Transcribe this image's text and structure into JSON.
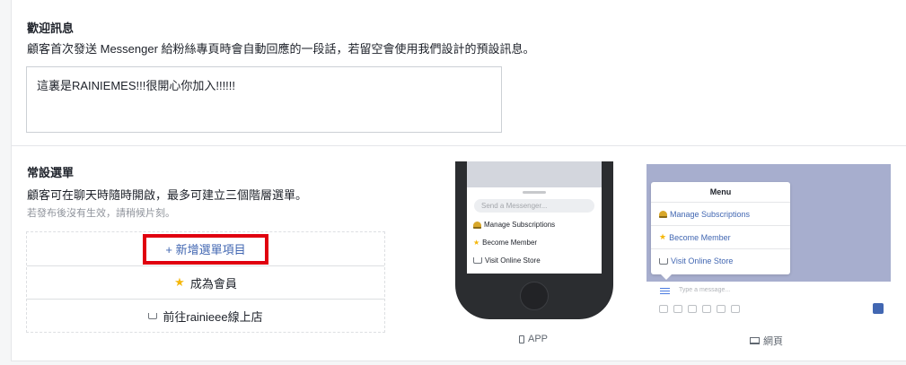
{
  "welcome": {
    "title": "歡迎訊息",
    "description": "顧客首次發送 Messenger 給粉絲專頁時會自動回應的一段話，若留空會使用我們設計的預設訊息。",
    "value": "這裏是RAINIEMES!!!很開心你加入!!!!!!"
  },
  "persistent_menu": {
    "title": "常設選單",
    "description": "顧客可在聊天時隨時開啟，最多可建立三個階層選單。",
    "hint": "若發布後沒有生效，請稍候片刻。",
    "add_label": "+ 新增選單項目",
    "items": [
      {
        "icon": "star-icon",
        "label": "成為會員"
      },
      {
        "icon": "cart-icon",
        "label": "前往rainieee線上店"
      }
    ]
  },
  "preview_app": {
    "input_placeholder": "Send a Messenger...",
    "items": [
      {
        "icon": "bell-icon",
        "label": "Manage Subscriptions"
      },
      {
        "icon": "star-icon",
        "label": "Become Member"
      },
      {
        "icon": "cart-icon",
        "label": "Visit Online Store"
      }
    ],
    "caption": "APP"
  },
  "preview_web": {
    "menu_title": "Menu",
    "items": [
      {
        "icon": "bell-icon",
        "label": "Manage Subscriptions"
      },
      {
        "icon": "star-icon",
        "label": "Become Member"
      },
      {
        "icon": "cart-icon",
        "label": "Visit Online Store"
      }
    ],
    "input_placeholder": "Type a message...",
    "caption": "網頁"
  },
  "colors": {
    "accent": "#4267b2",
    "highlight": "#e0000f",
    "border": "#dddfe2"
  }
}
